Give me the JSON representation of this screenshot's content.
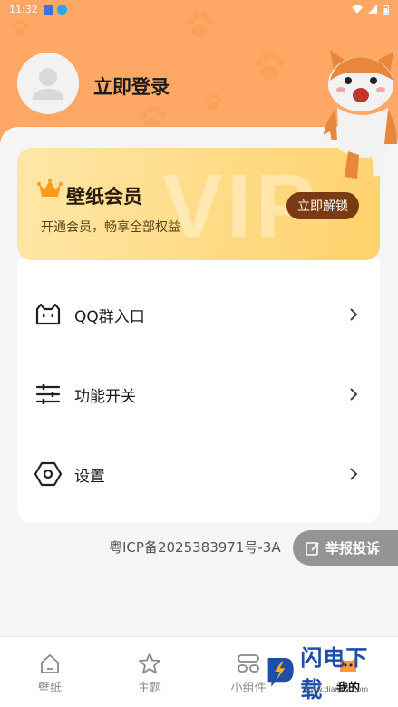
{
  "status_bar": {
    "time": "11:32"
  },
  "profile": {
    "login_label": "立即登录"
  },
  "vip": {
    "title": "壁纸会员",
    "subtitle": "开通会员，畅享全部权益",
    "button_label": "立即解锁",
    "watermark": "VIP"
  },
  "menu": {
    "items": [
      {
        "label": "QQ群入口",
        "icon": "qq-group-icon"
      },
      {
        "label": "功能开关",
        "icon": "sliders-icon"
      },
      {
        "label": "设置",
        "icon": "settings-hexagon-icon"
      }
    ]
  },
  "footer": {
    "icp": "粤ICP备2025383971号-3A"
  },
  "report": {
    "label": "举报投诉"
  },
  "tabs": [
    {
      "label": "壁纸",
      "icon": "home-icon"
    },
    {
      "label": "主题",
      "icon": "star-icon"
    },
    {
      "label": "小组件",
      "icon": "widget-icon"
    },
    {
      "label": "我的",
      "icon": "cat-face-icon"
    }
  ],
  "site_watermark": {
    "text": "闪电下载",
    "url": "www.dianxia.com"
  },
  "colors": {
    "accent": "#ffa866",
    "vip_button": "#7a3b12"
  }
}
